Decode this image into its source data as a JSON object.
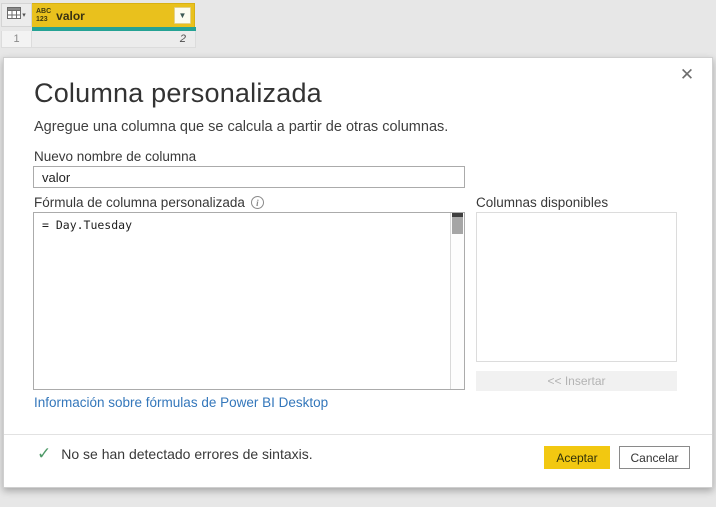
{
  "table_preview": {
    "corner": {
      "grid_icon": "table-grid-icon",
      "caret": "▾"
    },
    "column": {
      "type_icon_top": "ABC",
      "type_icon_bottom": "123",
      "name": "valor",
      "filter_caret": "▼"
    },
    "rows": [
      {
        "index": "1",
        "value": "2"
      }
    ],
    "colors": {
      "header_bg": "#e9c11d",
      "quality_bar": "#25a294"
    }
  },
  "dialog": {
    "close_glyph": "✕",
    "title": "Columna personalizada",
    "subtitle": "Agregue una columna que se calcula a partir de otras columnas.",
    "name_field": {
      "label": "Nuevo nombre de columna",
      "value": "valor"
    },
    "formula_field": {
      "label": "Fórmula de columna personalizada",
      "info_glyph": "i",
      "value": "= Day.Tuesday"
    },
    "available_columns": {
      "label": "Columnas disponibles",
      "items": [],
      "insert_button_label": "<< Insertar"
    },
    "link_text": "Información sobre fórmulas de Power BI Desktop",
    "status": {
      "check_glyph": "✓",
      "text": "No se han detectado errores de sintaxis."
    },
    "buttons": {
      "ok": "Aceptar",
      "cancel": "Cancelar"
    },
    "colors": {
      "accent": "#f2c811",
      "link": "#3477bb",
      "success": "#4f9a68"
    }
  }
}
